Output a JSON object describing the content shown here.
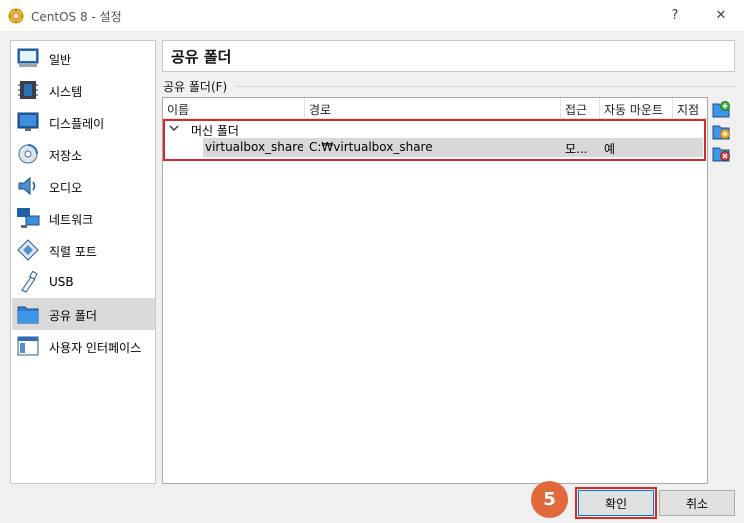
{
  "window": {
    "title": "CentOS 8 - 설정",
    "help_label": "?",
    "close_label": "✕",
    "app_icon": "virtualbox-gear-icon"
  },
  "sidebar": {
    "items": [
      {
        "label": "일반",
        "icon": "general-monitor-icon",
        "selected": false
      },
      {
        "label": "시스템",
        "icon": "system-chip-icon",
        "selected": false
      },
      {
        "label": "디스플레이",
        "icon": "display-monitor-icon",
        "selected": false
      },
      {
        "label": "저장소",
        "icon": "storage-disk-icon",
        "selected": false
      },
      {
        "label": "오디오",
        "icon": "audio-speaker-icon",
        "selected": false
      },
      {
        "label": "네트워크",
        "icon": "network-icon",
        "selected": false
      },
      {
        "label": "직렬 포트",
        "icon": "serial-port-icon",
        "selected": false
      },
      {
        "label": "USB",
        "icon": "usb-icon",
        "selected": false
      },
      {
        "label": "공유 폴더",
        "icon": "shared-folder-icon",
        "selected": true
      },
      {
        "label": "사용자 인터페이스",
        "icon": "user-interface-icon",
        "selected": false
      }
    ]
  },
  "main": {
    "page_title": "공유 폴더",
    "group_label": "공유 폴더(F)",
    "columns": [
      "이름",
      "경로",
      "접근",
      "자동 마운트",
      "지점"
    ],
    "group_row": {
      "label": "머신 폴더"
    },
    "shares": [
      {
        "name": "virtualbox_share",
        "path": "C:₩virtualbox_share",
        "access": "모...",
        "auto_mount": "예",
        "mount_point": ""
      }
    ],
    "tools": [
      "add-share-icon",
      "edit-share-icon",
      "remove-share-icon"
    ]
  },
  "footer": {
    "step_number": "5",
    "ok_label": "확인",
    "cancel_label": "취소"
  },
  "colors": {
    "highlight": "#d42a2a",
    "step_badge": "#e06a3c",
    "selected_bg": "#dadada",
    "row_selected_bg": "#d8d8d8"
  }
}
